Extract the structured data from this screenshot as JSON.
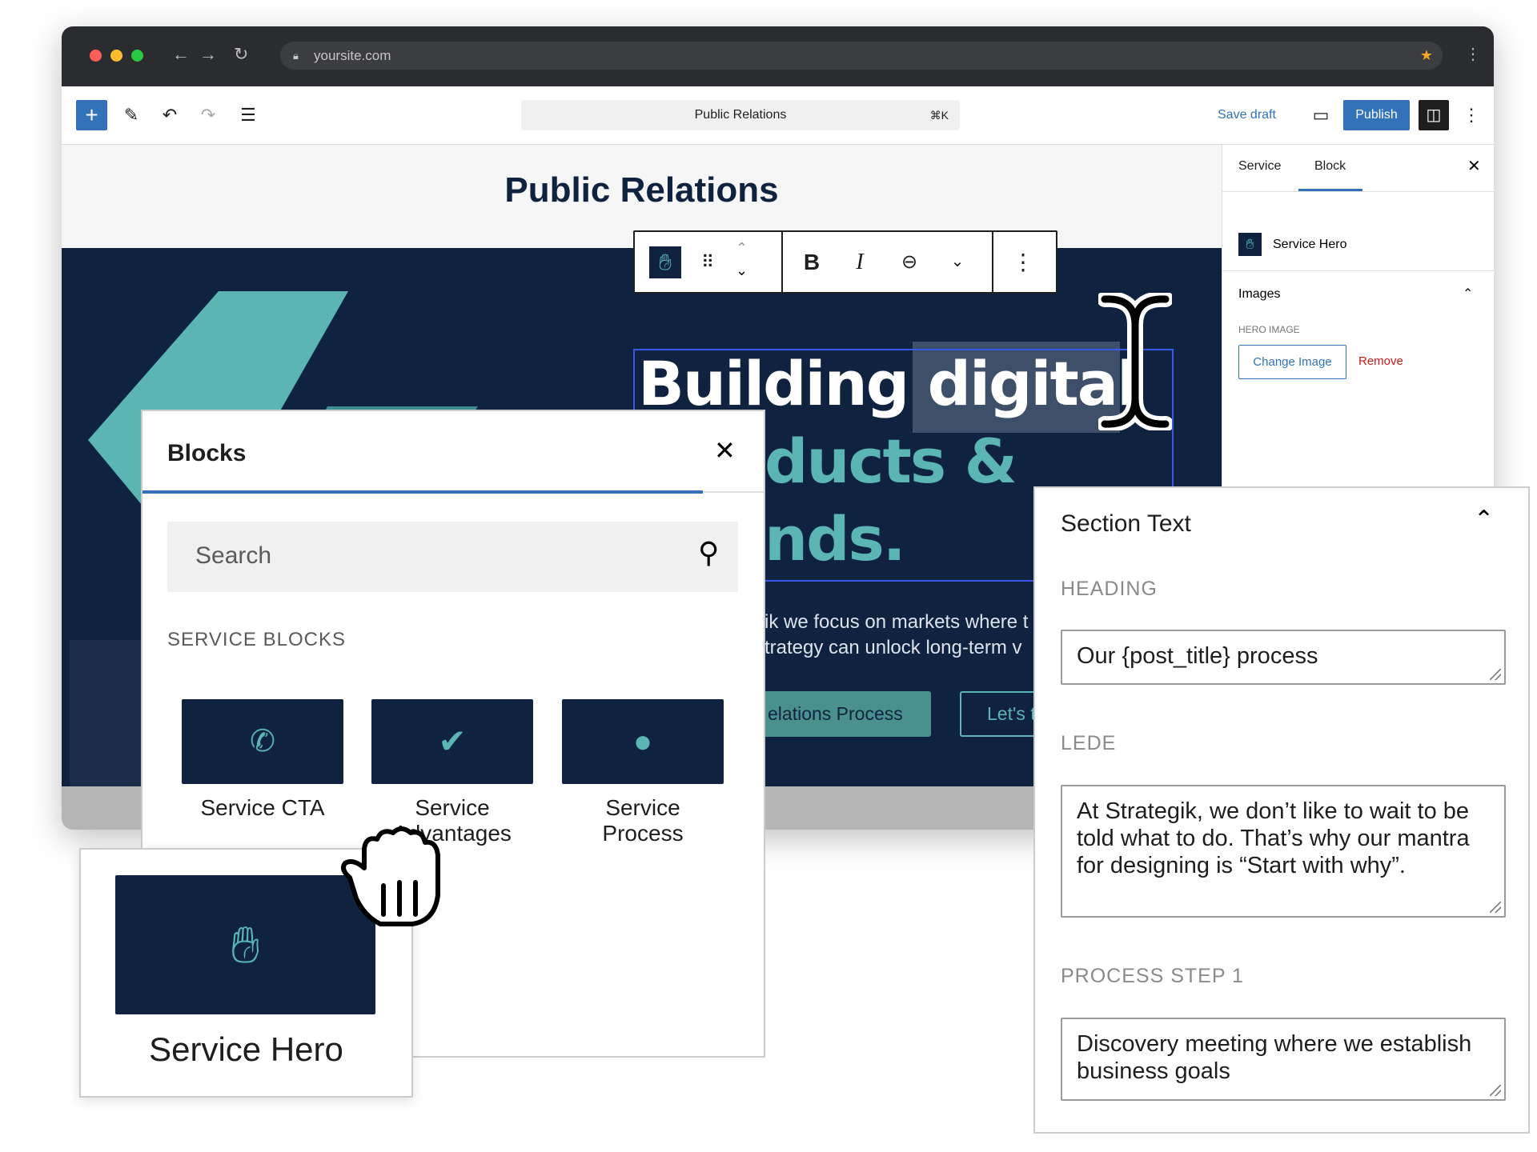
{
  "browser": {
    "url": "yoursite.com",
    "traffic_lights": [
      "#ff5f57",
      "#febc2e",
      "#28c840"
    ],
    "icons": [
      "back-icon",
      "forward-icon",
      "reload-icon",
      "lock-icon",
      "star-icon",
      "more-icon"
    ]
  },
  "toolbar": {
    "add": "+",
    "document_title": "Public Relations",
    "shortcut": "⌘K",
    "save_draft": "Save draft",
    "publish": "Publish",
    "accent": "#3272b8"
  },
  "canvas": {
    "title": "Public Relations",
    "hero": {
      "line1a": "Building ",
      "line1b": "digital",
      "line2": "ducts &",
      "line3": "nds.",
      "para1": "ik we focus on markets where t",
      "para2": "trategy can unlock long-term v",
      "button1": "elations Process",
      "button2": "Let's t",
      "teal": "#5ab5b3",
      "navy": "#0f2240"
    }
  },
  "block_toolbar": {
    "bold": "B",
    "italic": "I"
  },
  "sidebar": {
    "tabs": [
      {
        "label": "Service"
      },
      {
        "label": "Block",
        "active": true
      }
    ],
    "block_name": "Service Hero",
    "section": "Images",
    "field_label": "HERO IMAGE",
    "change_image": "Change Image",
    "remove": "Remove"
  },
  "blocks_panel": {
    "title": "Blocks",
    "search_placeholder": "Search",
    "category": "SERVICE BLOCKS",
    "items": [
      {
        "label": "Service CTA",
        "icon": "phone-icon"
      },
      {
        "label": "Service Advantages",
        "icon": "check-icon"
      },
      {
        "label": "Service Process",
        "icon": "compass-icon"
      }
    ]
  },
  "drag_card": {
    "label": "Service Hero",
    "icon": "wave-hand-icon"
  },
  "section_text": {
    "title": "Section Text",
    "heading_label": "HEADING",
    "heading_value": "Our {post_title} process",
    "lede_label": "LEDE",
    "lede_value": "At Strategik, we don’t like to wait to be told what to do. That’s why our mantra for designing is “Start with why”.",
    "step1_label": "PROCESS STEP 1",
    "step1_value": "Discovery meeting where we establish business goals"
  }
}
